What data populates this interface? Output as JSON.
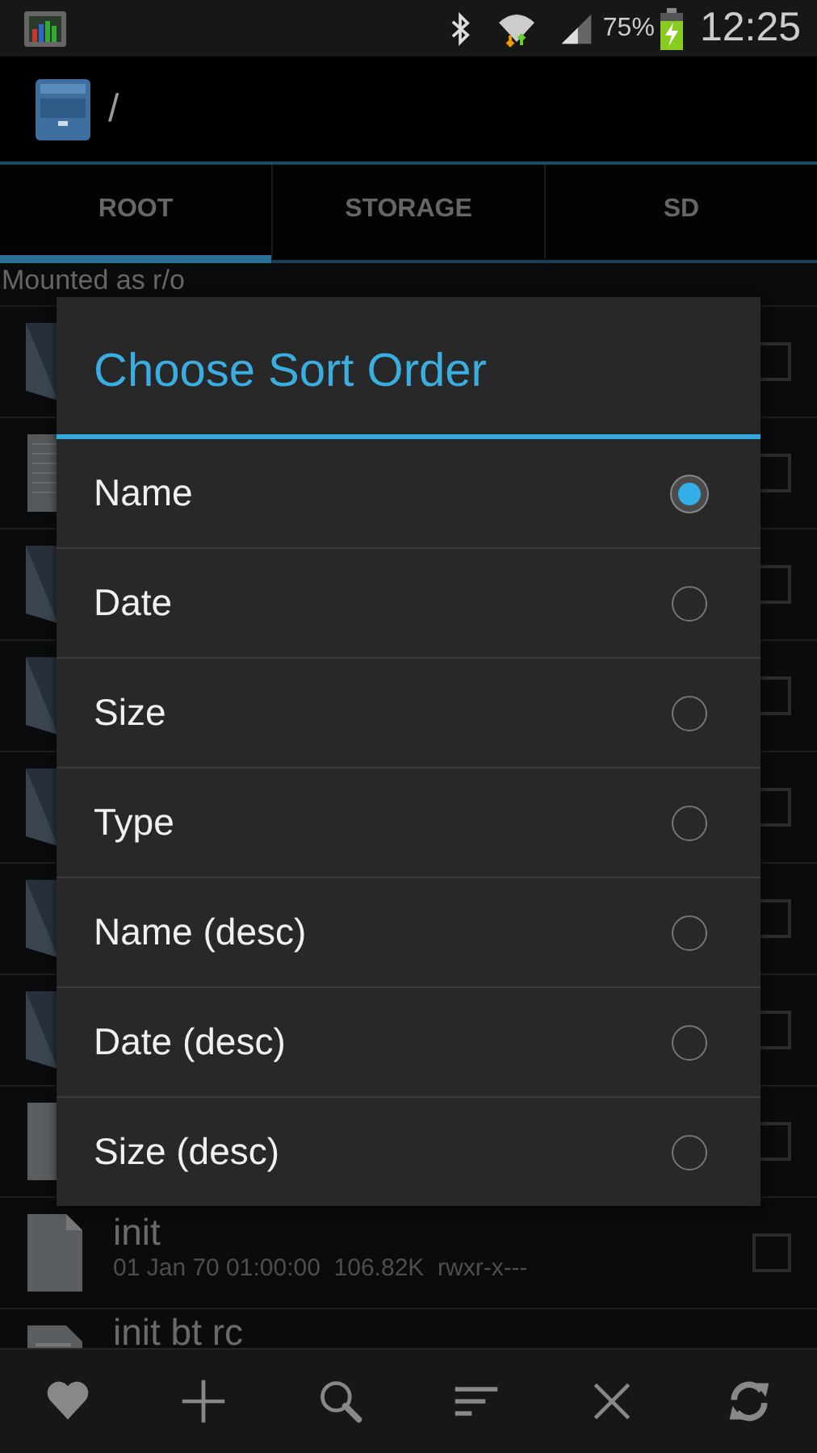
{
  "status_bar": {
    "battery": "75%",
    "time": "12:25"
  },
  "action_bar": {
    "path": "/"
  },
  "tabs": [
    {
      "label": "ROOT",
      "selected": true
    },
    {
      "label": "STORAGE",
      "selected": false
    },
    {
      "label": "SD",
      "selected": false
    }
  ],
  "mount_status": "Mounted as r/o",
  "files": [
    {
      "kind": "folder",
      "checked": false
    },
    {
      "kind": "device",
      "checked": false
    },
    {
      "kind": "folder",
      "checked": false
    },
    {
      "kind": "folder",
      "checked": false
    },
    {
      "kind": "folder",
      "checked": false
    },
    {
      "kind": "folder",
      "checked": false
    },
    {
      "kind": "folder",
      "checked": false
    },
    {
      "kind": "file",
      "checked": false
    },
    {
      "kind": "file",
      "name": "init",
      "details": "01 Jan 70 01:00:00  106.82K  rwxr-x---",
      "checked": false
    },
    {
      "kind": "text",
      "name": "init bt rc"
    }
  ],
  "dialog": {
    "title": "Choose Sort Order",
    "options": [
      {
        "label": "Name",
        "selected": true
      },
      {
        "label": "Date",
        "selected": false
      },
      {
        "label": "Size",
        "selected": false
      },
      {
        "label": "Type",
        "selected": false
      },
      {
        "label": "Name (desc)",
        "selected": false
      },
      {
        "label": "Date (desc)",
        "selected": false
      },
      {
        "label": "Size (desc)",
        "selected": false
      }
    ]
  },
  "toolbar": [
    {
      "kind": "favorite"
    },
    {
      "kind": "add"
    },
    {
      "kind": "search"
    },
    {
      "kind": "sort"
    },
    {
      "kind": "close"
    },
    {
      "kind": "refresh"
    }
  ]
}
